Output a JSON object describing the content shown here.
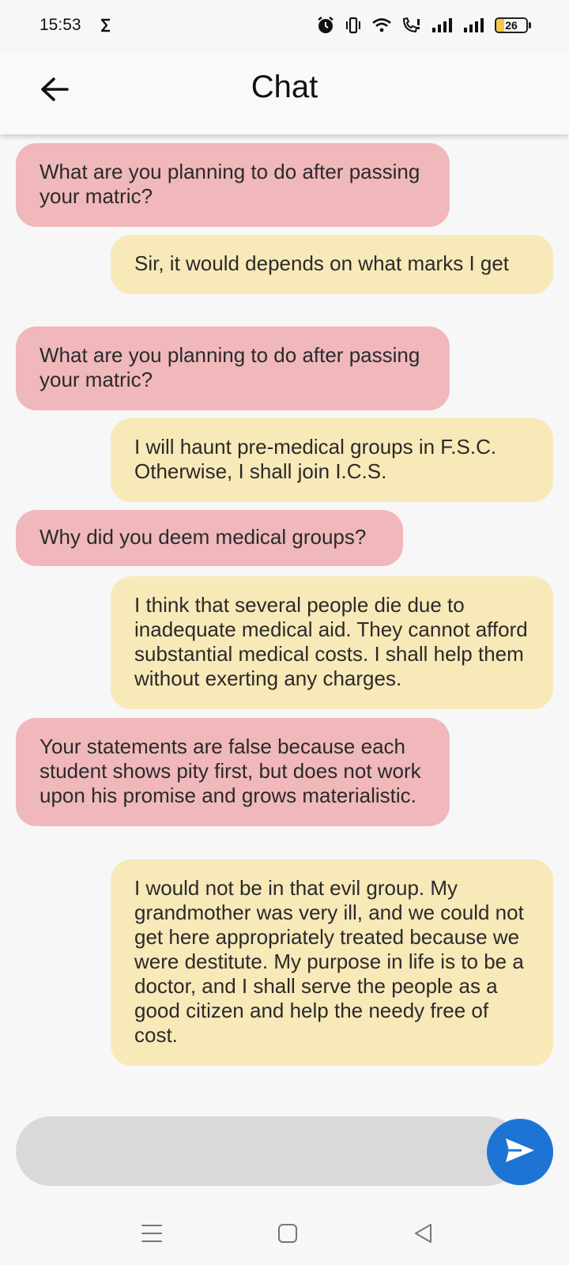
{
  "status_bar": {
    "time": "15:53",
    "battery": "26",
    "icons": [
      "data-saver-icon",
      "alarm-icon",
      "vibrate-icon",
      "wifi-icon",
      "wifi-calling-icon",
      "signal-1-icon",
      "signal-2-icon",
      "battery-icon"
    ]
  },
  "app_bar": {
    "title": "Chat",
    "back_icon": "back-arrow-icon"
  },
  "messages": [
    {
      "side": "received",
      "text": "What are you planning to do after passing your matric?"
    },
    {
      "side": "sent",
      "text": "Sir, it would depends on what marks I get"
    },
    {
      "side": "received",
      "text": "What are you planning to do after passing your matric?"
    },
    {
      "side": "sent",
      "text": "I will haunt pre-medical groups in F.S.C. Otherwise, I shall join I.C.S."
    },
    {
      "side": "received",
      "text": "Why did you deem medical groups?"
    },
    {
      "side": "sent",
      "text": "I think that several people die due to inadequate medical aid. They cannot afford substantial medical costs. I shall help them without exerting any charges."
    },
    {
      "side": "received",
      "text": "Your statements are false because each student shows pity first, but does not work upon his promise and grows materialistic."
    },
    {
      "side": "sent",
      "text": "I would not be in that evil group. My grandmother was very ill, and we could not get here appropriately treated because we were destitute. My purpose in life is to be a doctor, and I shall serve the people as a good citizen and help the needy free of cost."
    }
  ],
  "composer": {
    "value": "",
    "placeholder": "",
    "send_icon": "send-icon"
  },
  "nav_bar": {
    "icons": [
      "menu-icon",
      "home-icon",
      "back-icon"
    ]
  },
  "colors": {
    "received_bubble": "#f0b8bb",
    "sent_bubble": "#f8e9b8",
    "send_button": "#1e74d4",
    "input_background": "#d9d9d9",
    "background": "#f7f7f7"
  }
}
